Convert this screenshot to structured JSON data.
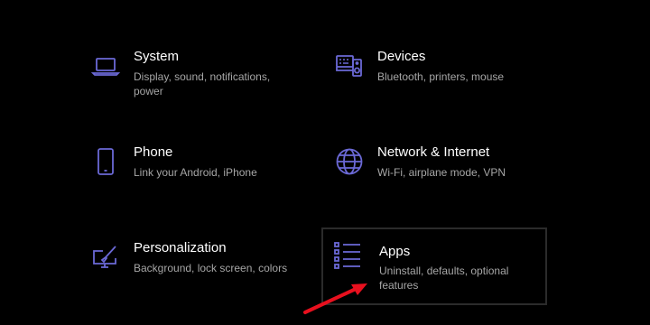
{
  "accent_color": "#6b69d6",
  "tiles": [
    {
      "title": "System",
      "description": "Display, sound, notifications, power",
      "icon": "laptop-icon"
    },
    {
      "title": "Devices",
      "description": "Bluetooth, printers, mouse",
      "icon": "keyboard-speaker-icon"
    },
    {
      "title": "Phone",
      "description": "Link your Android, iPhone",
      "icon": "phone-icon"
    },
    {
      "title": "Network & Internet",
      "description": "Wi-Fi, airplane mode, VPN",
      "icon": "globe-icon"
    },
    {
      "title": "Personalization",
      "description": "Background, lock screen, colors",
      "icon": "paint-brush-monitor-icon"
    },
    {
      "title": "Apps",
      "description": "Uninstall, defaults, optional features",
      "icon": "apps-list-icon"
    }
  ],
  "annotation": {
    "arrow_color": "#e8101e",
    "icon": "red-arrow-icon"
  }
}
